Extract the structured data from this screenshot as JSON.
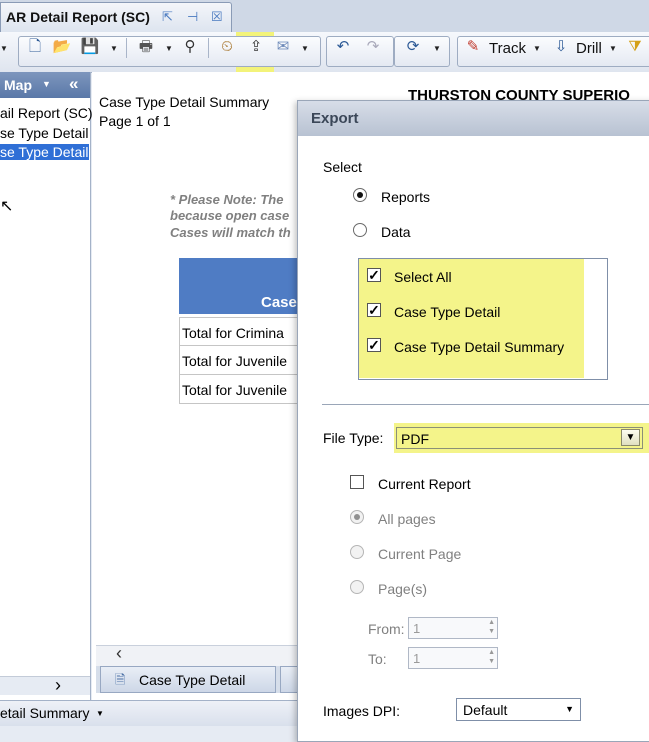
{
  "document_tab": {
    "title": "AR Detail Report (SC)"
  },
  "toolbar": {
    "track_label": "Track",
    "drill_label": "Drill"
  },
  "left_panel": {
    "header": "Map",
    "items": [
      "ail Report (SC)",
      "se Type Detail",
      "se Type Detail S"
    ]
  },
  "report": {
    "heading": "Case Type Detail Summary",
    "page": "Page 1 of 1",
    "county_title": "THURSTON COUNTY SUPERIO",
    "note_lines": [
      "* Please Note:  The",
      "because open case",
      "Cases will match th"
    ],
    "table_header": "Case",
    "rows": [
      "Total for  Crimina",
      "Total for  Juvenile",
      "Total for  Juvenile"
    ],
    "bottom_tab": "Case Type Detail"
  },
  "status": {
    "text": "etail Summary"
  },
  "export_dialog": {
    "title": "Export",
    "select_label": "Select",
    "options": {
      "reports": "Reports",
      "data": "Data",
      "selected": "Reports"
    },
    "checklist": [
      {
        "label": "Select All",
        "checked": true
      },
      {
        "label": "Case Type Detail",
        "checked": true
      },
      {
        "label": "Case Type Detail Summary",
        "checked": true
      }
    ],
    "file_type_label": "File Type:",
    "file_type_value": "PDF",
    "current_report_label": "Current Report",
    "current_report_checked": false,
    "pages": {
      "all": "All pages",
      "current": "Current Page",
      "range": "Page(s)",
      "selected": "All pages"
    },
    "from_label": "From:",
    "from_value": "1",
    "to_label": "To:",
    "to_value": "1",
    "dpi_label": "Images DPI:",
    "dpi_value": "Default"
  },
  "colors": {
    "highlight": "#f4f48a",
    "selection": "#2f6fd6",
    "table_header": "#4f7cc4"
  }
}
